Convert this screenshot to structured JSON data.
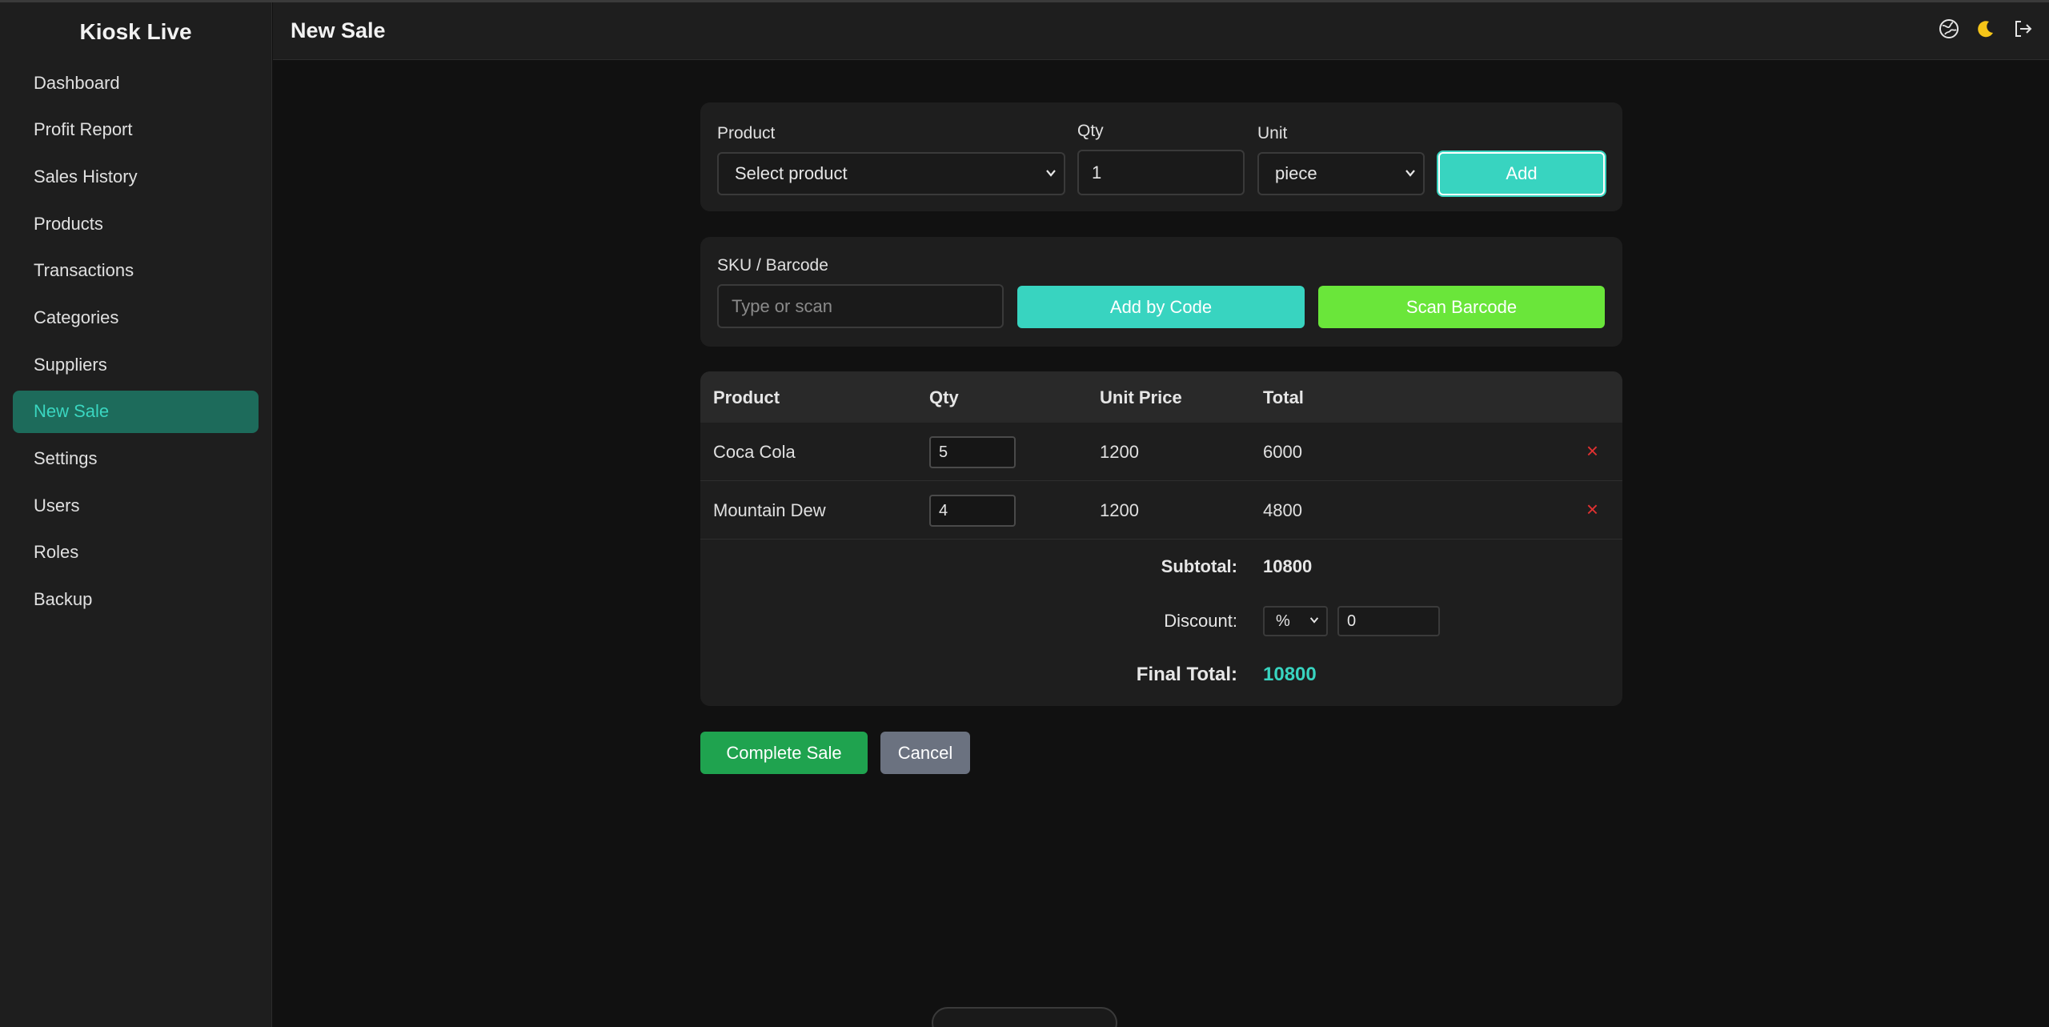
{
  "app": {
    "brand": "Kiosk Live",
    "page_title": "New Sale"
  },
  "sidebar": {
    "items": [
      {
        "label": "Dashboard"
      },
      {
        "label": "Profit Report"
      },
      {
        "label": "Sales History"
      },
      {
        "label": "Products"
      },
      {
        "label": "Transactions"
      },
      {
        "label": "Categories"
      },
      {
        "label": "Suppliers"
      },
      {
        "label": "New Sale",
        "active": true
      },
      {
        "label": "Settings"
      },
      {
        "label": "Users"
      },
      {
        "label": "Roles"
      },
      {
        "label": "Backup"
      }
    ]
  },
  "header_icons": [
    "globe-icon",
    "moon-icon",
    "logout-icon"
  ],
  "add_form": {
    "product_label": "Product",
    "product_value": "Select product",
    "qty_label": "Qty",
    "qty_value": "1",
    "unit_label": "Unit",
    "unit_value": "piece",
    "add_button": "Add"
  },
  "sku_form": {
    "label": "SKU / Barcode",
    "placeholder": "Type or scan",
    "add_by_code_button": "Add by Code",
    "scan_button": "Scan Barcode"
  },
  "cart": {
    "headers": [
      "Product",
      "Qty",
      "Unit Price",
      "Total"
    ],
    "rows": [
      {
        "product": "Coca Cola",
        "qty": "5",
        "unit_price": "1200",
        "total": "6000"
      },
      {
        "product": "Mountain Dew",
        "qty": "4",
        "unit_price": "1200",
        "total": "4800"
      }
    ],
    "remove_symbol": "×",
    "subtotal_label": "Subtotal:",
    "subtotal_value": "10800",
    "discount_label": "Discount:",
    "discount_type": "%",
    "discount_value": "0",
    "final_total_label": "Final Total:",
    "final_total_value": "10800"
  },
  "actions": {
    "complete": "Complete Sale",
    "cancel": "Cancel"
  },
  "colors": {
    "accent": "#38d4c0",
    "active_nav_bg": "#1d6b5b",
    "scan": "#6ae63a",
    "complete": "#1fa34f",
    "cancel": "#6b7280",
    "remove": "#e03131"
  }
}
